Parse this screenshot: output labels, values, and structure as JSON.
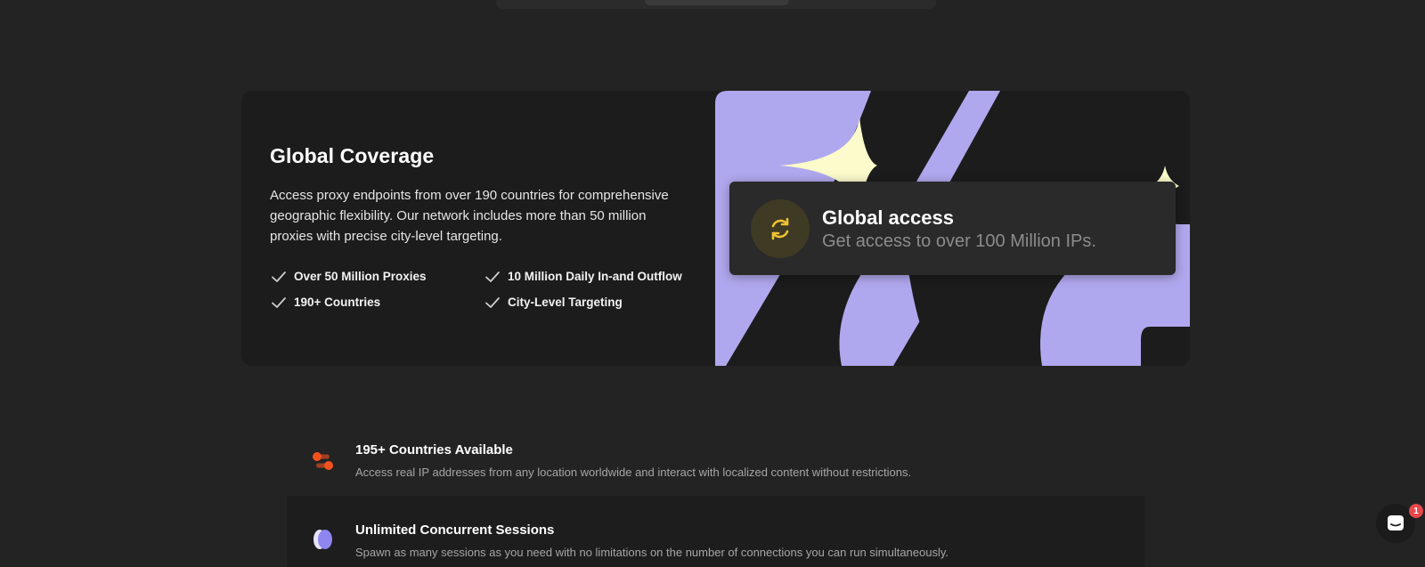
{
  "coverage": {
    "title": "Global Coverage",
    "description": "Access proxy endpoints from over 190 countries for comprehensive geographic flexibility. Our network includes more than 50 million proxies with precise city-level targeting.",
    "features": [
      "Over 50 Million Proxies",
      "10 Million Daily In-and Outflow",
      "190+ Countries",
      "City-Level Targeting"
    ]
  },
  "access_card": {
    "title": "Global access",
    "subtitle": "Get access to over 100 Million IPs."
  },
  "benefits": [
    {
      "title": "195+ Countries Available",
      "description": "Access real IP addresses from any location worldwide and interact with localized content without restrictions.",
      "icon": "toggle-icon"
    },
    {
      "title": "Unlimited Concurrent Sessions",
      "description": "Spawn as many sessions as you need with no limitations on the number of connections you can run simultaneously.",
      "icon": "circles-icon"
    }
  ],
  "chat": {
    "badge_count": "1",
    "icon": "chat-icon"
  },
  "colors": {
    "background": "#232323",
    "card": "#1c1c1c",
    "accent_purple": "#b0a8ee",
    "sparkle": "#fbfbcb",
    "refresh_yellow": "#f1c232",
    "orange": "#f4511e",
    "badge_red": "#e5484d"
  }
}
